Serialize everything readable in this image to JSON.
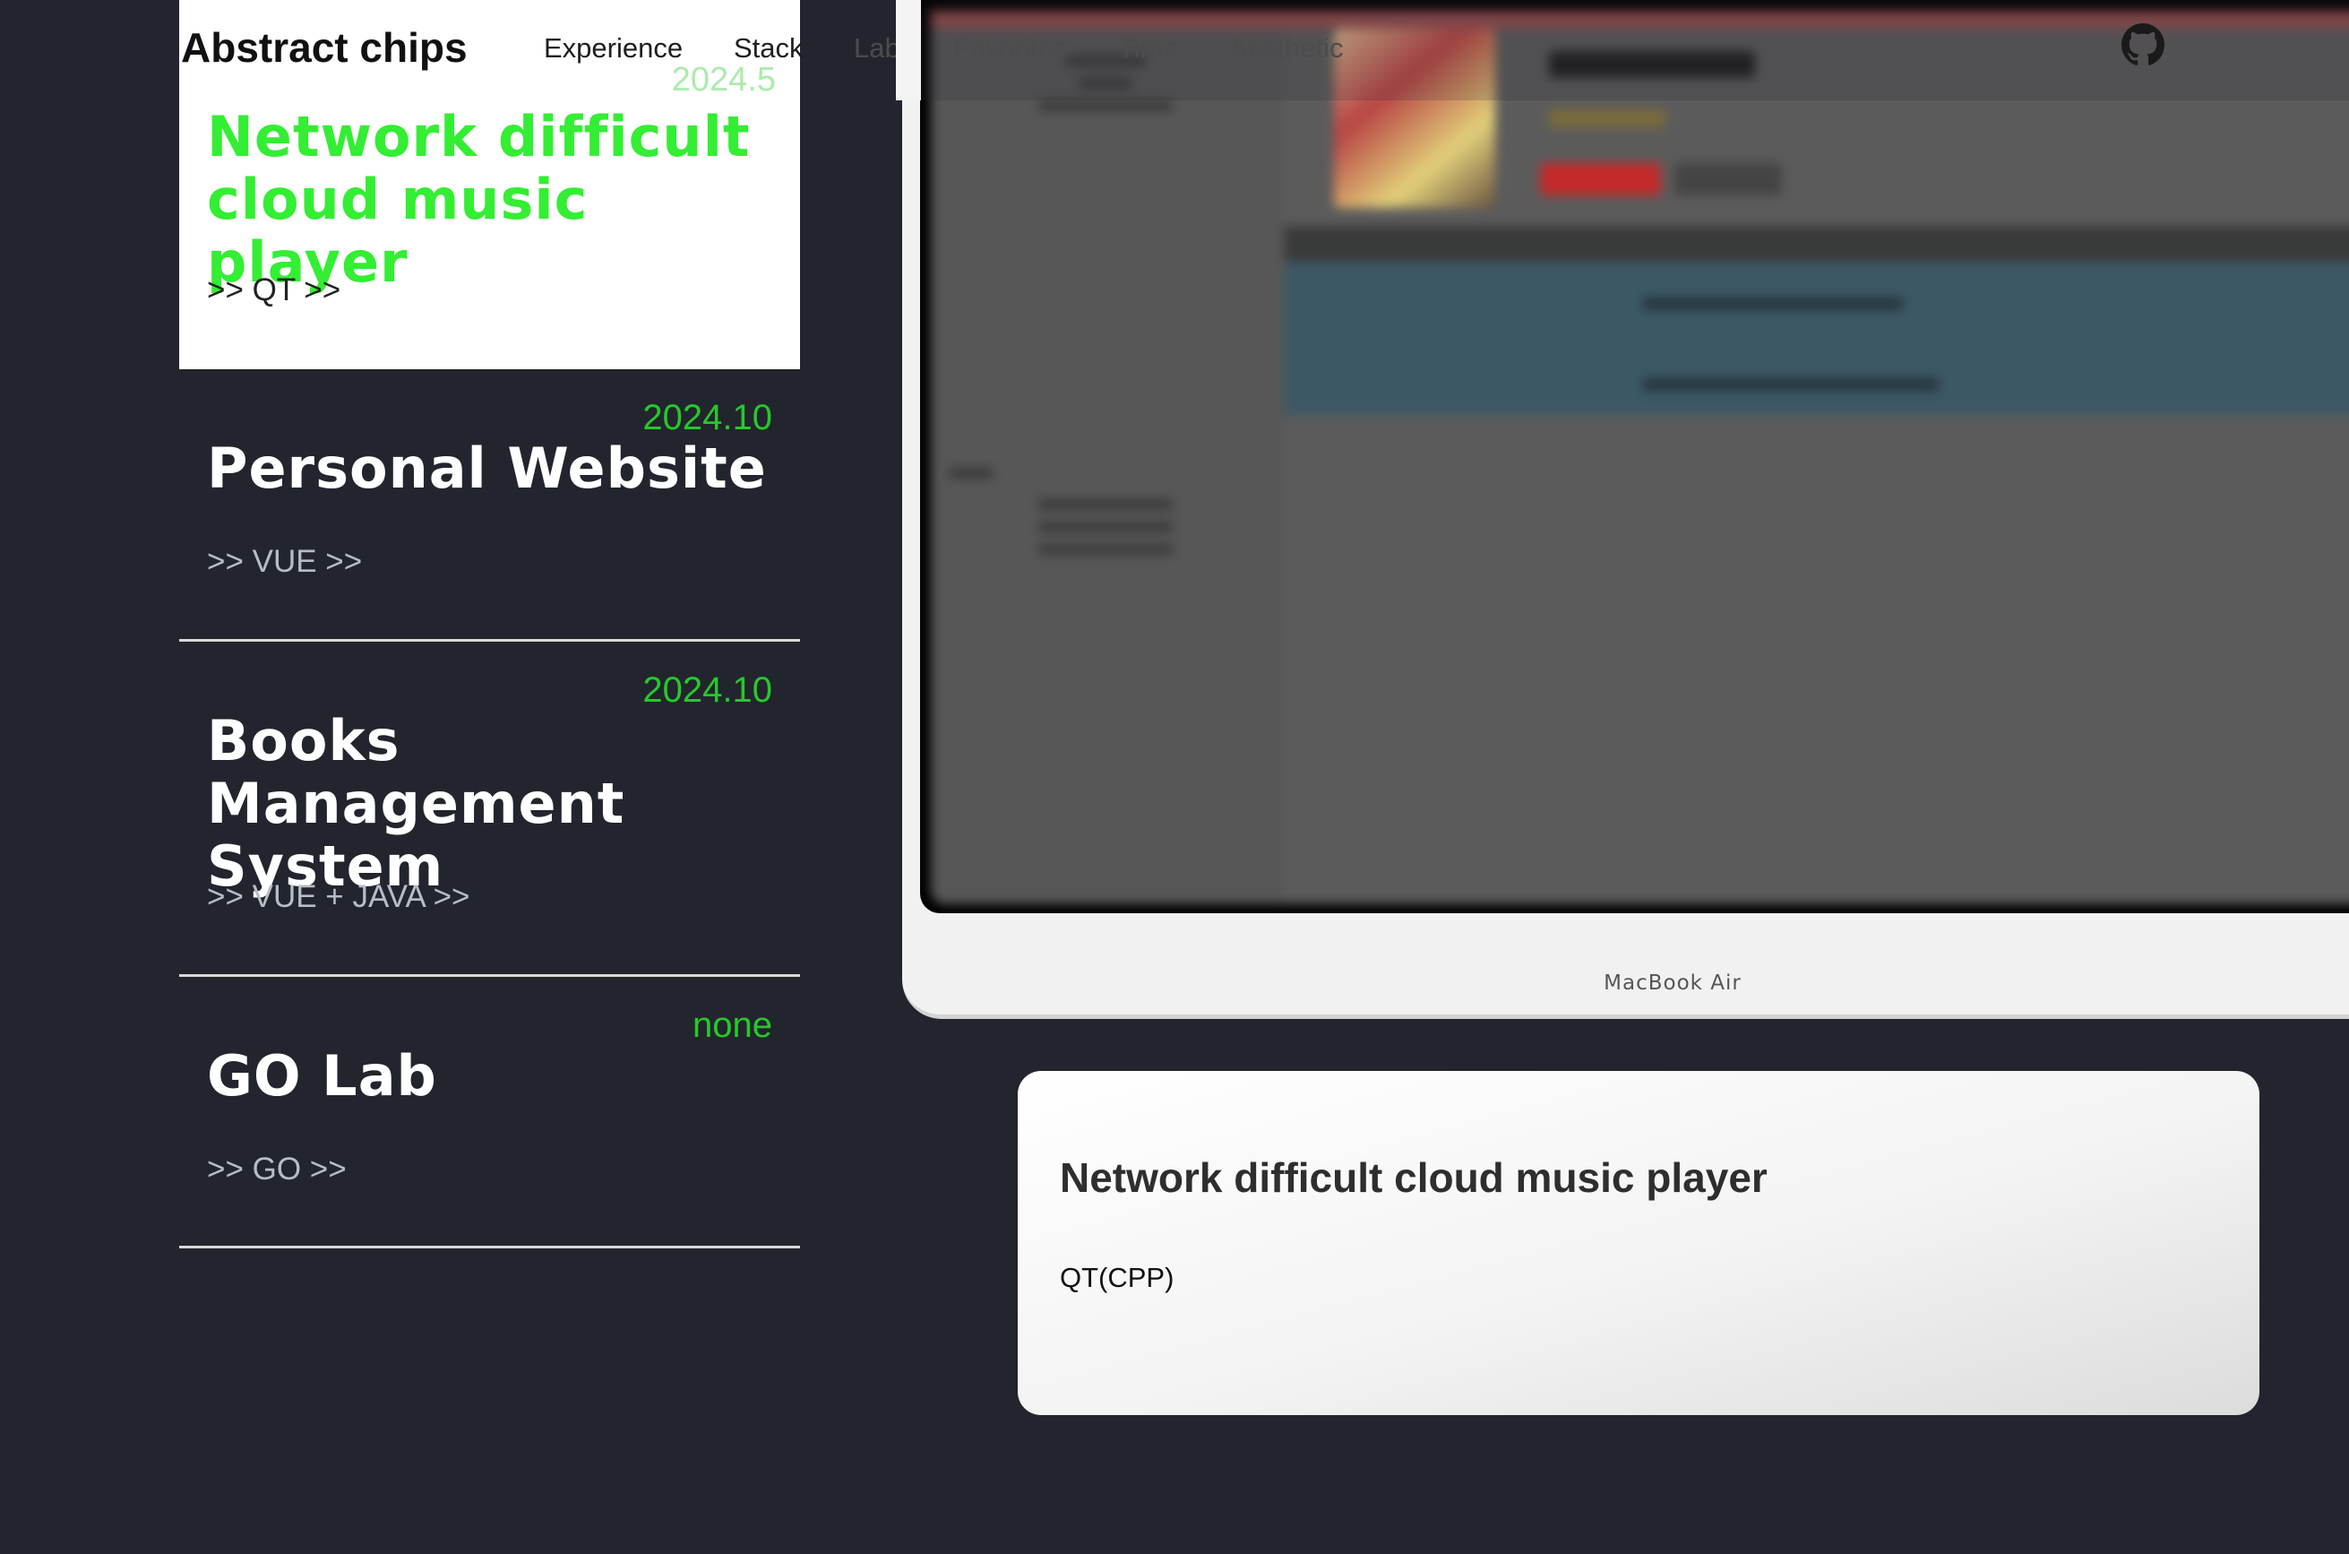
{
  "site": {
    "brand": "Abstract chips",
    "nav": [
      {
        "label": "Experience"
      },
      {
        "label": "Stack"
      },
      {
        "label": "Lab"
      },
      {
        "label": "Favorites"
      },
      {
        "label": "Time"
      },
      {
        "label": "Aesthetic"
      }
    ],
    "github_icon": "github-icon"
  },
  "projects": [
    {
      "date": "2024.5",
      "title": "Network difficult cloud music player",
      "tech": ">> QT >>",
      "active": true
    },
    {
      "date": "2024.10",
      "title": "Personal Website",
      "tech": ">> VUE >>",
      "active": false
    },
    {
      "date": "2024.10",
      "title": "Books Management System",
      "tech": ">> VUE + JAVA >>",
      "active": false
    },
    {
      "date": "none",
      "title": "GO Lab",
      "tech": ">> GO >>",
      "active": false
    }
  ],
  "preview": {
    "device_label": "MacBook Air"
  },
  "detail": {
    "title": "Network difficult cloud music player",
    "tech": "QT(CPP)"
  },
  "colors": {
    "background": "#22252d",
    "accent_green": "#33ee33",
    "date_green": "#27c82b"
  }
}
